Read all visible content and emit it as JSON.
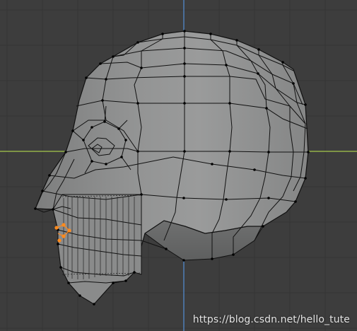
{
  "viewport": {
    "background": "#3d3d3d",
    "grid_color": "#353535",
    "x_axis_color": "#93b14a",
    "y_axis_color": "#4f7fb8",
    "mesh_face_color": "#8e8f8f",
    "mesh_edge_color": "#111111",
    "selection_color": "#ff8a1c"
  },
  "watermark": {
    "text": "https://blog.csdn.net/hello_tute"
  }
}
